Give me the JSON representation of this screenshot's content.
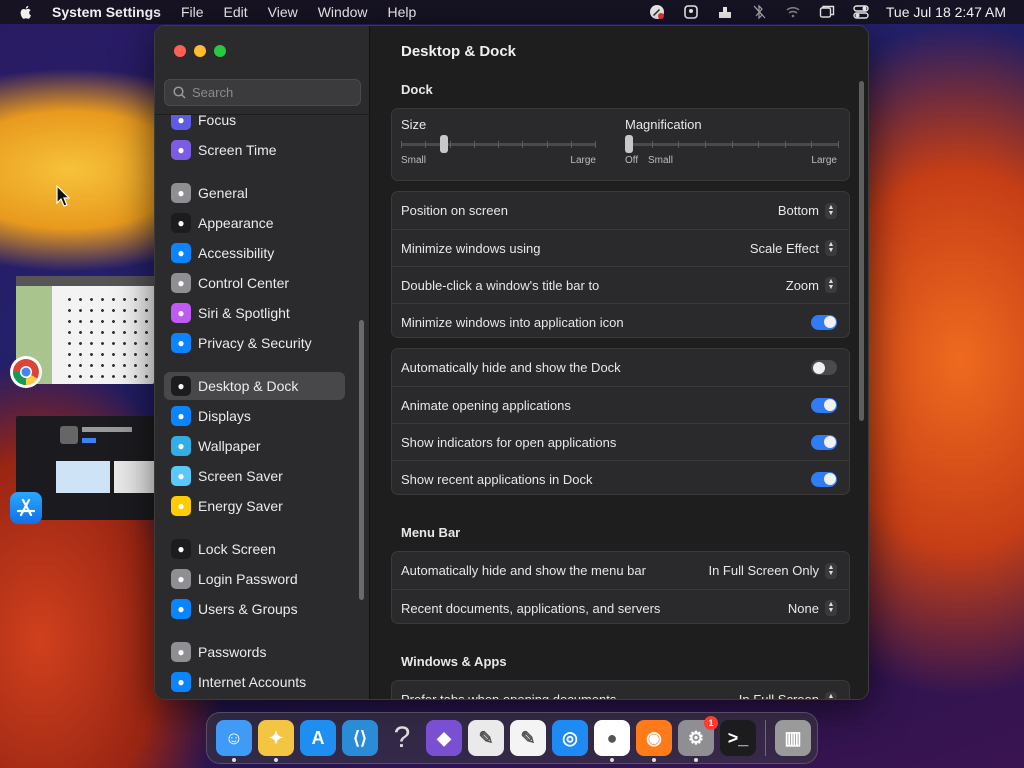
{
  "menubar": {
    "app_name": "System Settings",
    "items": [
      "File",
      "Edit",
      "View",
      "Window",
      "Help"
    ],
    "clock": "Tue Jul 18  2:47 AM"
  },
  "window": {
    "search": {
      "placeholder": "Search"
    },
    "sidebar": [
      {
        "label": "Focus",
        "icon": "moon-icon",
        "color": "#5e5ce6"
      },
      {
        "label": "Screen Time",
        "icon": "hourglass-icon",
        "color": "#7c5ce6"
      },
      {
        "label": "General",
        "icon": "gear-icon",
        "color": "#8e8e93"
      },
      {
        "label": "Appearance",
        "icon": "appearance-icon",
        "color": "#1c1c1e"
      },
      {
        "label": "Accessibility",
        "icon": "accessibility-icon",
        "color": "#0a84ff"
      },
      {
        "label": "Control Center",
        "icon": "control-center-icon",
        "color": "#8e8e93"
      },
      {
        "label": "Siri & Spotlight",
        "icon": "siri-icon",
        "color": "#bf5af2"
      },
      {
        "label": "Privacy & Security",
        "icon": "hand-icon",
        "color": "#0a84ff"
      },
      {
        "label": "Desktop & Dock",
        "icon": "dock-icon",
        "color": "#1c1c1e"
      },
      {
        "label": "Displays",
        "icon": "sun-icon",
        "color": "#0a84ff"
      },
      {
        "label": "Wallpaper",
        "icon": "wallpaper-icon",
        "color": "#32ade6"
      },
      {
        "label": "Screen Saver",
        "icon": "screen-saver-icon",
        "color": "#5ac8fa"
      },
      {
        "label": "Energy Saver",
        "icon": "bulb-icon",
        "color": "#ffcc00"
      },
      {
        "label": "Lock Screen",
        "icon": "lock-icon",
        "color": "#1c1c1e"
      },
      {
        "label": "Login Password",
        "icon": "padlock-icon",
        "color": "#8e8e93"
      },
      {
        "label": "Users & Groups",
        "icon": "users-icon",
        "color": "#0a84ff"
      },
      {
        "label": "Passwords",
        "icon": "key-icon",
        "color": "#8e8e93"
      },
      {
        "label": "Internet Accounts",
        "icon": "at-icon",
        "color": "#0a84ff"
      }
    ],
    "selected": "Desktop & Dock",
    "main": {
      "title": "Desktop & Dock",
      "dock_header": "Dock",
      "size_slider": {
        "label": "Size",
        "min": "Small",
        "max": "Large",
        "value": 0.22
      },
      "magnification_slider": {
        "label": "Magnification",
        "off": "Off",
        "min": "Small",
        "max": "Large",
        "value": 0.0
      },
      "rows1": [
        {
          "label": "Position on screen",
          "value": "Bottom"
        },
        {
          "label": "Minimize windows using",
          "value": "Scale Effect"
        },
        {
          "label": "Double-click a window's title bar to",
          "value": "Zoom"
        },
        {
          "label": "Minimize windows into application icon",
          "toggle": "on"
        }
      ],
      "rows2": [
        {
          "label": "Automatically hide and show the Dock",
          "toggle": "off"
        },
        {
          "label": "Animate opening applications",
          "toggle": "on"
        },
        {
          "label": "Show indicators for open applications",
          "toggle": "on"
        },
        {
          "label": "Show recent applications in Dock",
          "toggle": "on"
        }
      ],
      "menubar_header": "Menu Bar",
      "rows3": [
        {
          "label": "Automatically hide and show the menu bar",
          "value": "In Full Screen Only"
        },
        {
          "label": "Recent documents, applications, and servers",
          "value": "None"
        }
      ],
      "windows_header": "Windows & Apps",
      "rows4": [
        {
          "label": "Prefer tabs when opening documents",
          "value": "In Full Screen"
        }
      ]
    }
  },
  "dock": {
    "apps": [
      "Finder",
      "Cyberduck",
      "App Store",
      "Visual Studio Code",
      "Help",
      "Visual Studio",
      "Script Editor",
      "TextEdit",
      "Safari",
      "Google Chrome",
      "Firefox",
      "System Settings",
      "Terminal",
      "Trash"
    ],
    "badge": "1",
    "accent": "#2f7cf6"
  }
}
